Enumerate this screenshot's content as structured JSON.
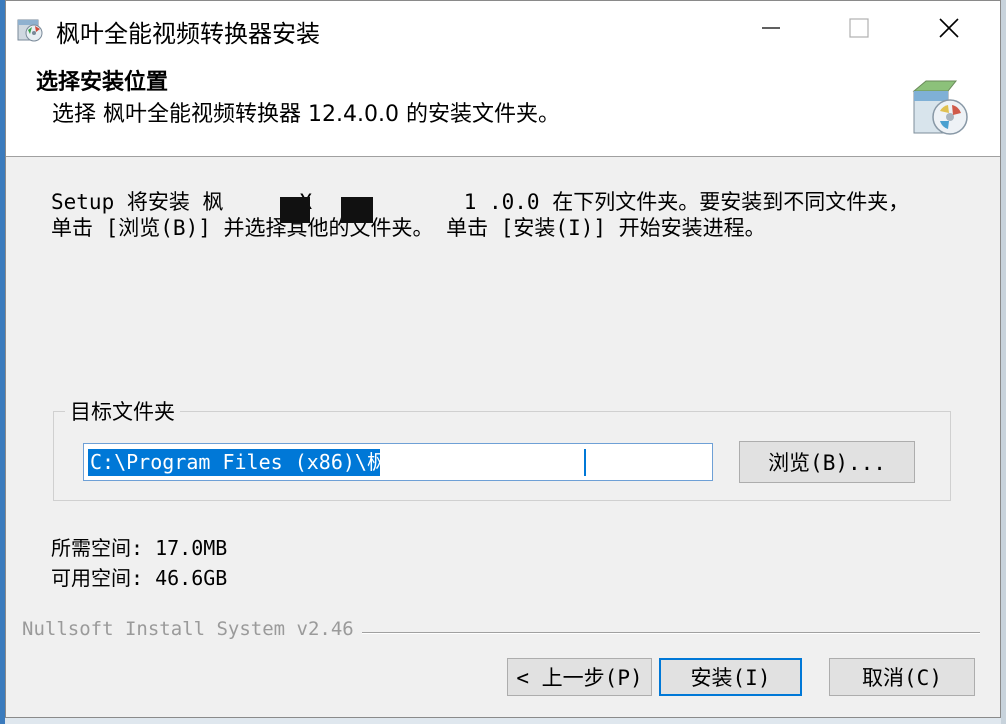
{
  "window": {
    "title": "枫叶全能视频转换器安装",
    "icon": "installer-disc-icon",
    "controls": [
      "minimize-icon",
      "maximize-icon",
      "close-icon"
    ]
  },
  "header": {
    "title": "选择安装位置",
    "subtitle": "选择 枫叶全能视频转换器 12.4.0.0 的安装文件夹。",
    "icon": "installer-box-icon"
  },
  "description": {
    "line1": "Setup 将安装 枫      X            1 .0.0 在下列文件夹。要安装到不同文件夹，",
    "line2": "单击 [浏览(B)] 并选择其他的文件夹。 单击 [安装(I)] 开始安装进程。"
  },
  "destination": {
    "group_label": "目标文件夹",
    "path_value": "C:\\Program Files (x86)\\枫",
    "browse_label": "浏览(B)..."
  },
  "space": {
    "required": "所需空间: 17.0MB",
    "available": "可用空间: 46.6GB"
  },
  "footer": {
    "branding": "Nullsoft Install System v2.46",
    "back_label": "< 上一步(P)",
    "install_label": "安装(I)",
    "cancel_label": "取消(C)"
  },
  "colors": {
    "accent": "#0078d7",
    "window_bg": "#f0f0f0",
    "header_bg": "#ffffff"
  }
}
